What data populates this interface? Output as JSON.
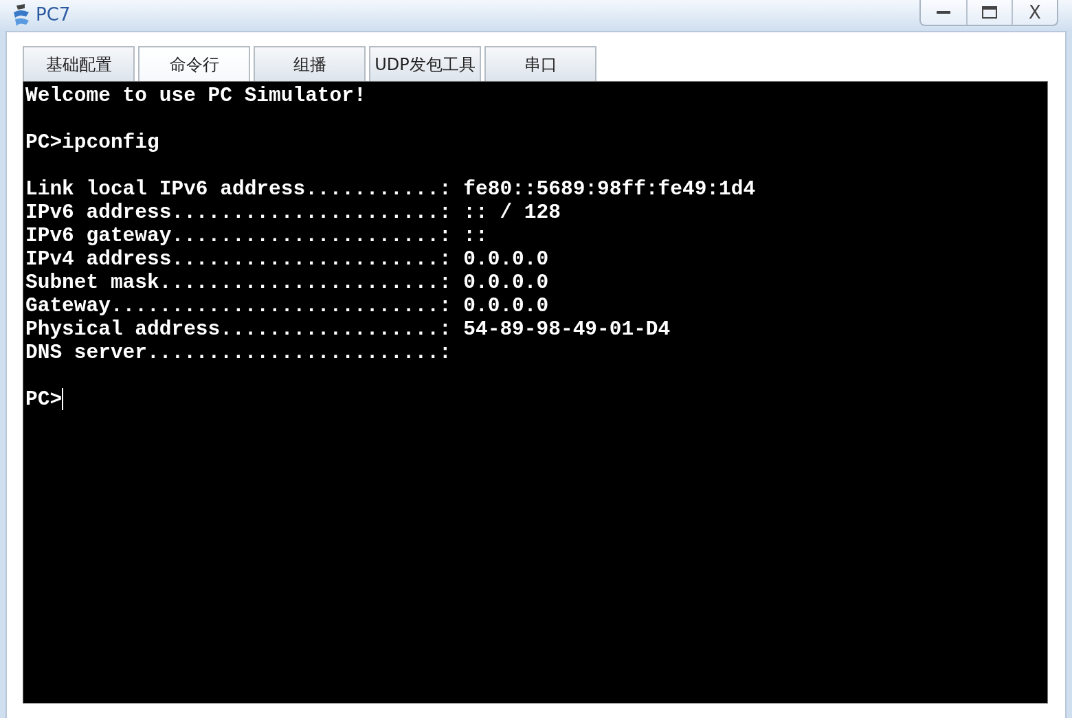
{
  "window": {
    "title": "PC7",
    "close": "X"
  },
  "tabs": [
    {
      "label": "基础配置",
      "selected": false
    },
    {
      "label": "命令行",
      "selected": true
    },
    {
      "label": "组播",
      "selected": false
    },
    {
      "label": "UDP发包工具",
      "selected": false
    },
    {
      "label": "串口",
      "selected": false
    }
  ],
  "terminal": {
    "blocks": [
      [
        "Welcome to use PC Simulator!"
      ],
      [
        "PC>ipconfig"
      ],
      [
        "Link local IPv6 address...........: fe80::5689:98ff:fe49:1d4",
        "IPv6 address......................: :: / 128",
        "IPv6 gateway......................: ::",
        "IPv4 address......................: 0.0.0.0",
        "Subnet mask.......................: 0.0.0.0",
        "Gateway...........................: 0.0.0.0",
        "Physical address..................: 54-89-98-49-01-D4",
        "DNS server........................:"
      ],
      [
        "PC>"
      ]
    ],
    "cursor": true
  }
}
